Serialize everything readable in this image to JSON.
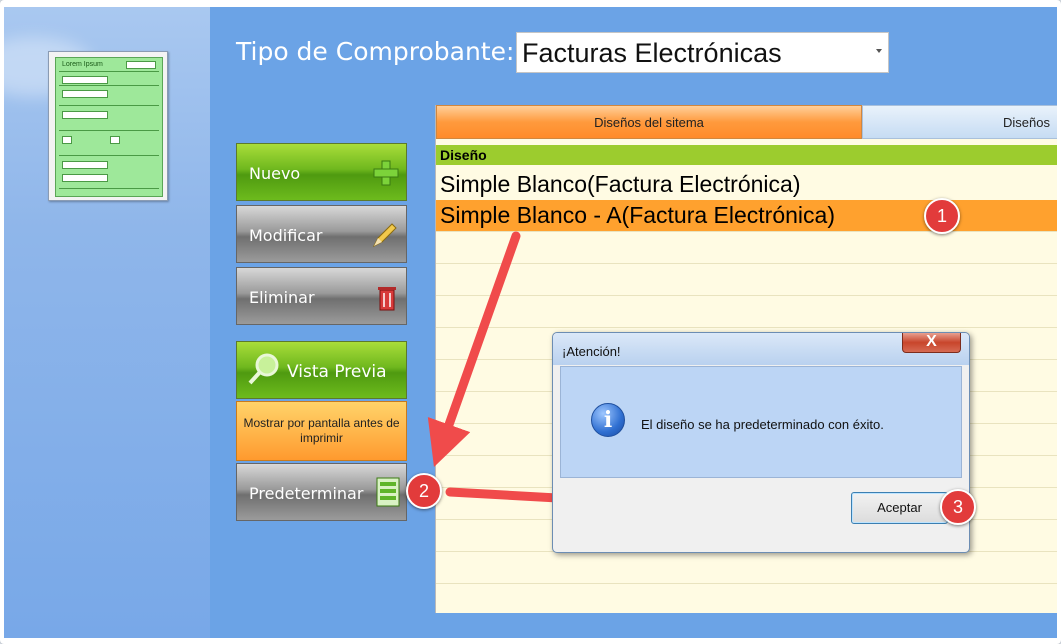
{
  "header": {
    "type_label": "Tipo de Comprobante:",
    "type_value": "Facturas Electrónicas"
  },
  "buttons": {
    "nuevo": "Nuevo",
    "modificar": "Modificar",
    "eliminar": "Eliminar",
    "vista_previa": "Vista Previa",
    "mostrar_info": "Mostrar por pantalla antes de imprimir",
    "predeterminar": "Predeterminar"
  },
  "icons": {
    "nuevo": "plus-icon",
    "modificar": "pencil-icon",
    "eliminar": "trash-icon",
    "vista_previa": "magnifier-icon",
    "predeterminar": "list-icon"
  },
  "tabs": [
    {
      "label": "Diseños del sitema"
    },
    {
      "label": "Diseños"
    }
  ],
  "grid": {
    "column_header": "Diseño",
    "rows": [
      {
        "label": "Simple Blanco(Factura Electrónica)"
      },
      {
        "label": "Simple Blanco - A(Factura Electrónica)"
      }
    ]
  },
  "dialog": {
    "title": "¡Atención!",
    "message": "El diseño se ha predeterminado con éxito.",
    "ok_label": "Aceptar",
    "close_glyph": "X",
    "info_glyph": "i"
  },
  "badges": [
    "1",
    "2",
    "3"
  ],
  "thumbnail": {
    "title": "Lorem Ipsum"
  },
  "colors": {
    "accent_green": "#6fb81e",
    "selection_orange": "#ffa12e",
    "badge_red": "#e23b3b",
    "arrow_red": "#f04b4b"
  }
}
